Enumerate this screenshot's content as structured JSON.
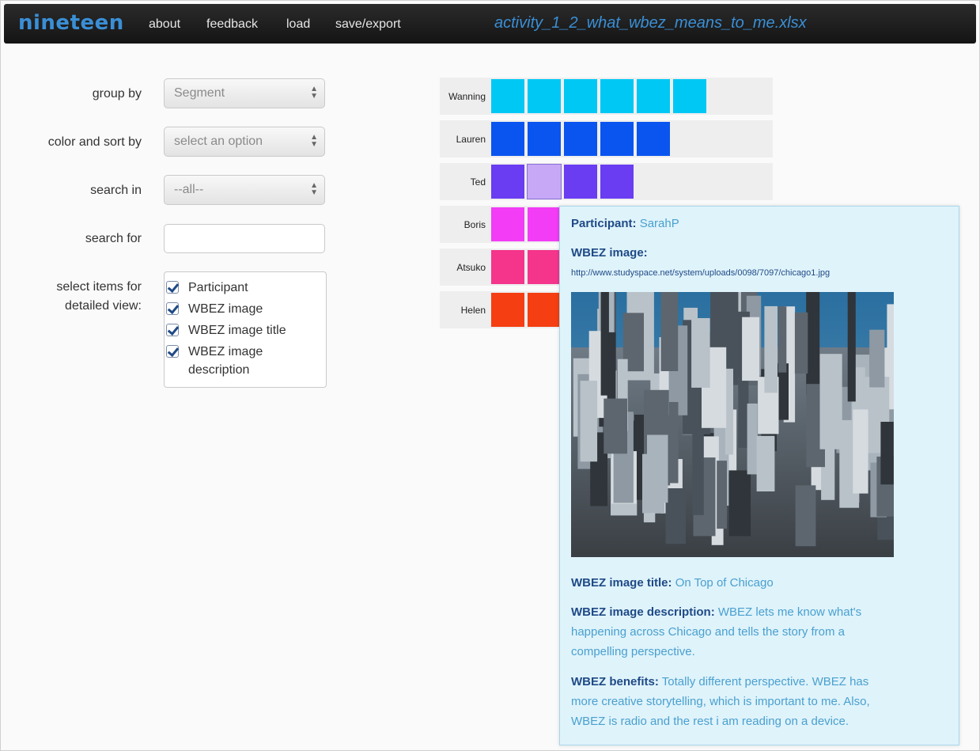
{
  "header": {
    "brand": "nineteen",
    "nav": [
      "about",
      "feedback",
      "load",
      "save/export"
    ],
    "file_title": "activity_1_2_what_wbez_means_to_me.xlsx",
    "accent": "#3a8fd6"
  },
  "controls": {
    "group_by_label": "group by",
    "group_by_value": "Segment",
    "color_sort_label": "color and sort by",
    "color_sort_value": "select an option",
    "search_in_label": "search in",
    "search_in_value": "--all--",
    "search_for_label": "search for",
    "search_for_value": "",
    "select_items_label_1": "select items for",
    "select_items_label_2": "detailed view:",
    "items": [
      "Participant",
      "WBEZ image",
      "WBEZ image title",
      "WBEZ image",
      "description"
    ]
  },
  "chart": {
    "rows": [
      {
        "label": "Wanning",
        "count": 6,
        "color": "#00c8f5"
      },
      {
        "label": "Lauren",
        "count": 5,
        "color": "#0a55f0"
      },
      {
        "label": "Ted",
        "count": 4,
        "color": "#6a3cf2",
        "selected_index": 1,
        "selected_color": "#c7a8f7"
      },
      {
        "label": "Boris",
        "count": 2,
        "color": "#f23cf5"
      },
      {
        "label": "Atsuko",
        "count": 2,
        "color": "#f5348c"
      },
      {
        "label": "Helen",
        "count": 2,
        "color": "#f53e12"
      }
    ]
  },
  "popup": {
    "participant_key": "Participant:",
    "participant_value": "SarahP",
    "image_key": "WBEZ image:",
    "image_url": "http://www.studyspace.net/system/uploads/0098/7097/chicago1.jpg",
    "title_key": "WBEZ image title:",
    "title_value": "On Top of Chicago",
    "description_key": "WBEZ image description:",
    "description_value_1": "WBEZ lets me know what's",
    "description_value_2": "happening across Chicago and tells the story from a",
    "description_value_3": "compelling perspective.",
    "benefits_key": "WBEZ benefits:",
    "benefits_value_1": "Totally different perspective. WBEZ has",
    "benefits_value_2": "more creative storytelling, which is important to me. Also,",
    "benefits_value_3": "WBEZ is radio and the rest i am reading on a device."
  }
}
